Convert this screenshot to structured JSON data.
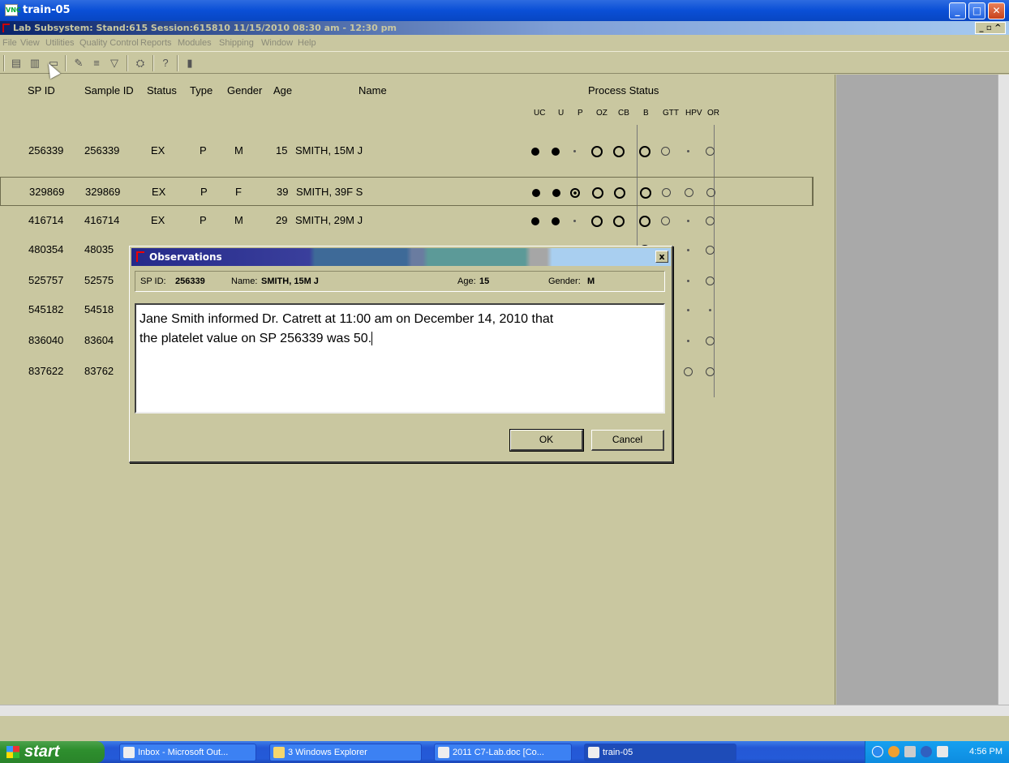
{
  "window": {
    "title": "train-05",
    "icon_text": "VNC"
  },
  "mdi": {
    "title": "Lab Subsystem: Stand:615 Session:615810 11/15/2010 08:30 am - 12:30 pm"
  },
  "menu": [
    "File",
    "View",
    "Utilities",
    "Quality Control",
    "Reports",
    "Modules",
    "Shipping",
    "Window",
    "Help"
  ],
  "columns": {
    "sp_id": "SP ID",
    "sample_id": "Sample ID",
    "status": "Status",
    "type": "Type",
    "gender": "Gender",
    "age": "Age",
    "name": "Name",
    "process_status": "Process Status",
    "process_cols": [
      "UC",
      "U",
      "P",
      "OZ",
      "CB",
      "B",
      "GTT",
      "HPV",
      "OR"
    ]
  },
  "rows": [
    {
      "sp_id": "256339",
      "sample_id": "256339",
      "status": "EX",
      "type": "P",
      "gender": "M",
      "age": "15",
      "name": "SMITH, 15M J",
      "marks": [
        "filled",
        "filled",
        "dot",
        "ringb",
        "ringb",
        "ringb",
        "ringl",
        "dot",
        "ringl"
      ]
    },
    {
      "sp_id": "329869",
      "sample_id": "329869",
      "status": "EX",
      "type": "P",
      "gender": "F",
      "age": "39",
      "name": "SMITH, 39F S",
      "marks": [
        "filled",
        "filled",
        "dotted",
        "ringb",
        "ringb",
        "ringb",
        "ringl",
        "ringl",
        "ringl"
      ],
      "selected": true
    },
    {
      "sp_id": "416714",
      "sample_id": "416714",
      "status": "EX",
      "type": "P",
      "gender": "M",
      "age": "29",
      "name": "SMITH, 29M J",
      "marks": [
        "filled",
        "filled",
        "dot",
        "ringb",
        "ringb",
        "ringb",
        "ringl",
        "dot",
        "ringl"
      ]
    },
    {
      "sp_id": "480354",
      "sample_id": "48035",
      "marks_partial": [
        "ringb",
        "ringl",
        "dot",
        "ringl"
      ]
    },
    {
      "sp_id": "525757",
      "sample_id": "52575",
      "marks_partial": [
        "ringb",
        "ringl",
        "dot",
        "ringl"
      ]
    },
    {
      "sp_id": "545182",
      "sample_id": "54518",
      "marks_partial": [
        "ringb",
        "dot",
        "dot",
        "dot"
      ]
    },
    {
      "sp_id": "836040",
      "sample_id": "83604",
      "marks_partial": [
        "ringb",
        "ringl",
        "dot",
        "ringl"
      ]
    },
    {
      "sp_id": "837622",
      "sample_id": "83762",
      "marks_partial": [
        "ringb",
        "ringl",
        "ringl",
        "ringl"
      ]
    }
  ],
  "dialog": {
    "title": "Observations",
    "sp_id_label": "SP ID:",
    "sp_id_value": "256339",
    "name_label": "Name:",
    "name_value": "SMITH, 15M J",
    "age_label": "Age:",
    "age_value": "15",
    "gender_label": "Gender:",
    "gender_value": "M",
    "text_line1": "Jane Smith informed Dr. Catrett at 11:00 am on December 14, 2010 that",
    "text_line2": "the platelet value on SP 256339 was 50.",
    "ok_label": "OK",
    "cancel_label": "Cancel",
    "close_label": "x"
  },
  "taskbar": {
    "start_label": "start",
    "tasks": [
      "Inbox - Microsoft Out...",
      "3 Windows Explorer",
      "2011 C7-Lab.doc [Co...",
      "train-05"
    ],
    "clock": "4:56 PM"
  }
}
